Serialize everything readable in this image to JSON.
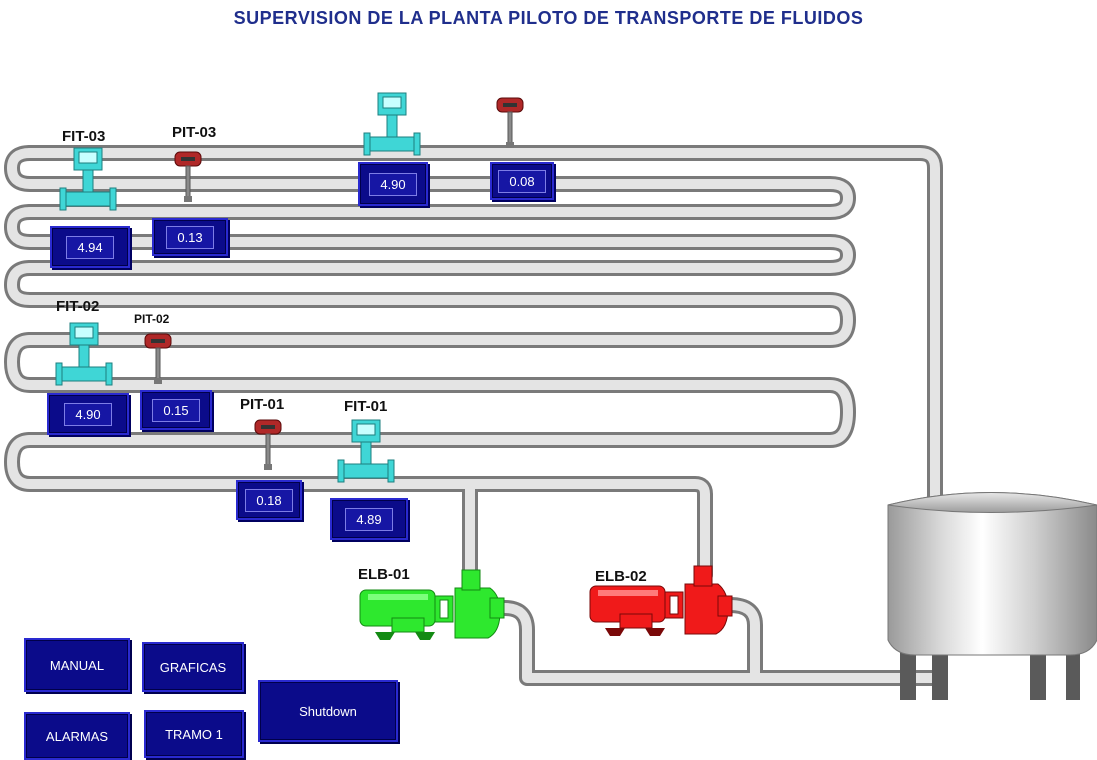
{
  "title": "SUPERVISION DE LA PLANTA PILOTO DE TRANSPORTE DE FLUIDOS",
  "instruments": {
    "fit03": {
      "tag": "FIT-03",
      "value": "4.94"
    },
    "pit03": {
      "tag": "PIT-03",
      "value": "0.13"
    },
    "fit_top": {
      "value": "4.90"
    },
    "pit_top": {
      "value": "0.08"
    },
    "fit02": {
      "tag": "FIT-02",
      "value": "4.90"
    },
    "pit02": {
      "tag": "PIT-02",
      "value": "0.15"
    },
    "pit01": {
      "tag": "PIT-01",
      "value": "0.18"
    },
    "fit01": {
      "tag": "FIT-01",
      "value": "4.89"
    }
  },
  "pumps": {
    "elb01": {
      "tag": "ELB-01",
      "color": "#2ee82e"
    },
    "elb02": {
      "tag": "ELB-02",
      "color": "#f01a1a"
    }
  },
  "buttons": {
    "manual": "MANUAL",
    "graficas": "GRAFICAS",
    "shutdown": "Shutdown",
    "alarmas": "ALARMAS",
    "tramo1": "TRAMO 1"
  },
  "colors": {
    "display_bg": "#0b0b8a",
    "flowmeter": "#3fd6d6",
    "pressure": "#b02828",
    "pipe": "#c9c9c9"
  }
}
